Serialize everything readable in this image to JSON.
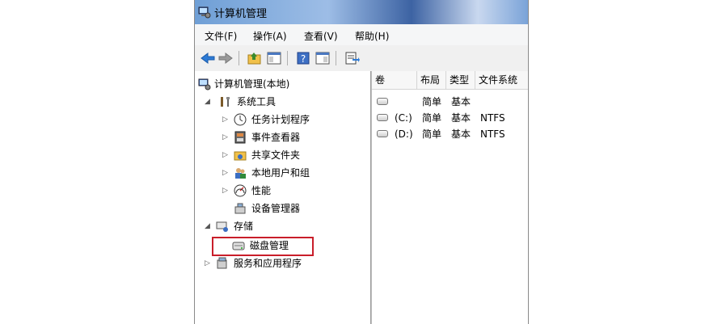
{
  "window": {
    "title": "计算机管理"
  },
  "menu": [
    "文件(F)",
    "操作(A)",
    "查看(V)",
    "帮助(H)"
  ],
  "toolbar": {
    "buttons": [
      "back-arrow-icon",
      "forward-arrow-icon",
      "up-folder-icon",
      "show-hide-tree-icon",
      "help-icon",
      "show-hide-action-pane-icon",
      "export-list-icon"
    ]
  },
  "tree": {
    "root": "计算机管理(本地)",
    "system_tools": "系统工具",
    "task_scheduler": "任务计划程序",
    "event_viewer": "事件查看器",
    "shared_folders": "共享文件夹",
    "local_users": "本地用户和组",
    "performance": "性能",
    "device_manager": "设备管理器",
    "storage": "存储",
    "disk_management": "磁盘管理",
    "services_apps": "服务和应用程序"
  },
  "list": {
    "columns": [
      "卷",
      "布局",
      "类型",
      "文件系统"
    ],
    "rows": [
      {
        "volume": "",
        "layout": "简单",
        "type": "基本",
        "fs": ""
      },
      {
        "volume": "(C:)",
        "layout": "简单",
        "type": "基本",
        "fs": "NTFS"
      },
      {
        "volume": "(D:)",
        "layout": "简单",
        "type": "基本",
        "fs": "NTFS"
      }
    ]
  },
  "colors": {
    "highlight_box": "#c91e2a",
    "toolbar_arrow": "#2d7bd6"
  }
}
